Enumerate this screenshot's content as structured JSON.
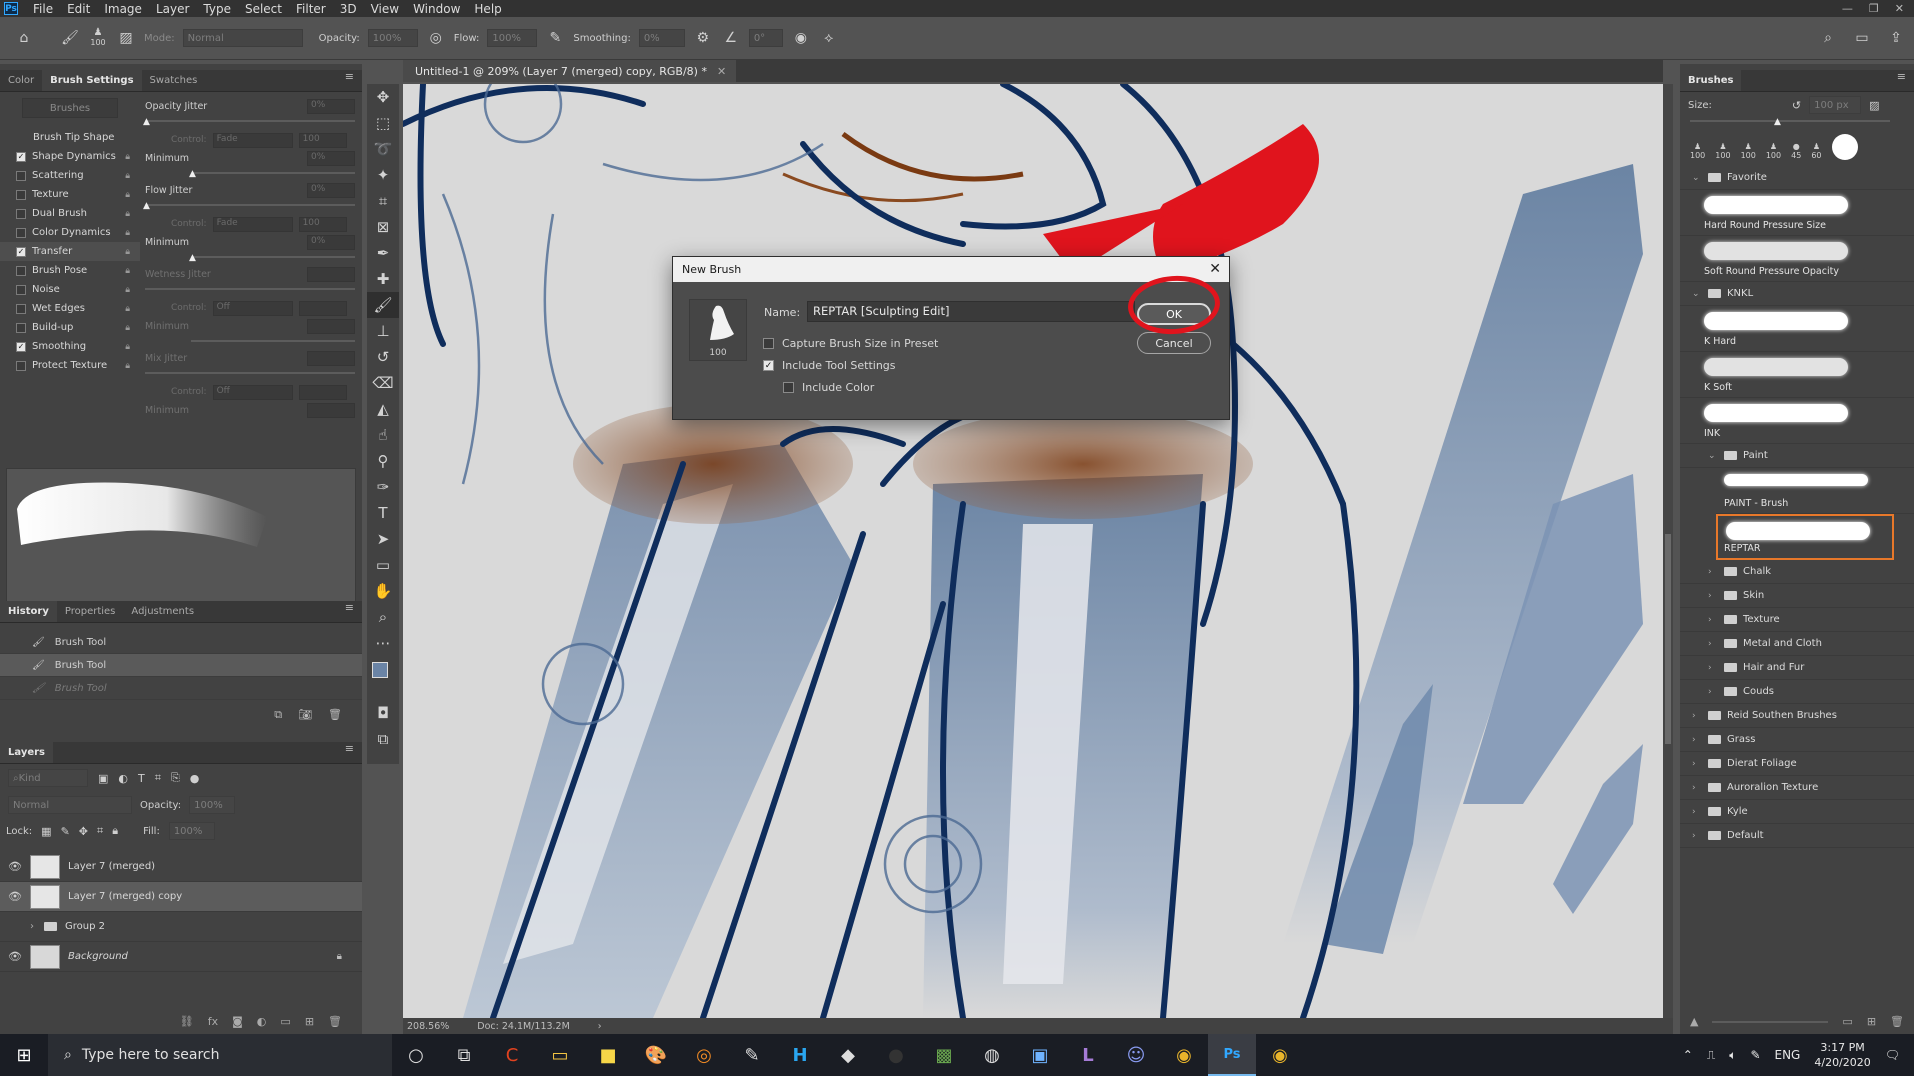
{
  "menubar": {
    "logo": "Ps",
    "items": [
      "File",
      "Edit",
      "Image",
      "Layer",
      "Type",
      "Select",
      "Filter",
      "3D",
      "View",
      "Window",
      "Help"
    ]
  },
  "options_bar": {
    "brush_size": "100",
    "mode_label": "Mode:",
    "mode_value": "Normal",
    "opacity_label": "Opacity:",
    "opacity_value": "100%",
    "flow_label": "Flow:",
    "flow_value": "100%",
    "smoothing_label": "Smoothing:",
    "smoothing_value": "0%",
    "angle_value": "0°"
  },
  "brush_settings_panel": {
    "tabs": [
      "Color",
      "Brush Settings",
      "Swatches"
    ],
    "brushes_button": "Brushes",
    "brush_tip_shape": "Brush Tip Shape",
    "options": [
      {
        "label": "Shape Dynamics",
        "checked": true
      },
      {
        "label": "Scattering",
        "checked": false
      },
      {
        "label": "Texture",
        "checked": false
      },
      {
        "label": "Dual Brush",
        "checked": false
      },
      {
        "label": "Color Dynamics",
        "checked": false
      },
      {
        "label": "Transfer",
        "checked": true
      },
      {
        "label": "Brush Pose",
        "checked": false
      },
      {
        "label": "Noise",
        "checked": false
      },
      {
        "label": "Wet Edges",
        "checked": false
      },
      {
        "label": "Build-up",
        "checked": false
      },
      {
        "label": "Smoothing",
        "checked": true
      },
      {
        "label": "Protect Texture",
        "checked": false
      }
    ],
    "opacity_jitter_label": "Opacity Jitter",
    "opacity_jitter_value": "0%",
    "control_label": "Control:",
    "control_fade": "Fade",
    "control_fade_value": "100",
    "minimum_label": "Minimum",
    "minimum_value": "0%",
    "flow_jitter_label": "Flow Jitter",
    "flow_jitter_value": "0%",
    "wetness_jitter_label": "Wetness Jitter",
    "control_off": "Off",
    "mix_jitter_label": "Mix Jitter"
  },
  "history_panel": {
    "tabs": [
      "History",
      "Properties",
      "Adjustments"
    ],
    "items": [
      {
        "label": "Brush Tool",
        "state": "normal"
      },
      {
        "label": "Brush Tool",
        "state": "selected"
      },
      {
        "label": "Brush Tool",
        "state": "dim"
      }
    ]
  },
  "layers_panel": {
    "tab": "Layers",
    "kind_placeholder": "Kind",
    "blend_mode": "Normal",
    "opacity_label": "Opacity:",
    "opacity_value": "100%",
    "lock_label": "Lock:",
    "fill_label": "Fill:",
    "fill_value": "100%",
    "layers": [
      {
        "name": "Layer 7 (merged)",
        "visible": true,
        "selected": false
      },
      {
        "name": "Layer 7 (merged) copy",
        "visible": true,
        "selected": true
      },
      {
        "name": "Group 2",
        "visible": false,
        "selected": false,
        "type": "group"
      },
      {
        "name": "Background",
        "visible": true,
        "selected": false,
        "locked": true
      }
    ]
  },
  "document": {
    "tab_title": "Untitled-1 @ 209% (Layer 7 (merged) copy, RGB/8) *",
    "zoom": "208.56%",
    "doc_size": "Doc: 24.1M/113.2M"
  },
  "dialog": {
    "title": "New Brush",
    "preview_size": "100",
    "name_label": "Name:",
    "name_value": "REPTAR [Sculpting Edit]",
    "capture_size_label": "Capture Brush Size in Preset",
    "capture_size_checked": false,
    "include_tool_label": "Include Tool Settings",
    "include_tool_checked": true,
    "include_color_label": "Include Color",
    "include_color_checked": false,
    "ok_label": "OK",
    "cancel_label": "Cancel"
  },
  "brushes_panel": {
    "tab": "Brushes",
    "size_label": "Size:",
    "size_value": "100 px",
    "recent_sizes": [
      "100",
      "100",
      "100",
      "100",
      "45",
      "60"
    ],
    "folders": [
      {
        "name": "Favorite",
        "expanded": true,
        "items": [
          "Hard Round Pressure Size",
          "Soft Round Pressure Opacity"
        ]
      },
      {
        "name": "KNKL",
        "expanded": true,
        "items": [
          "K Hard",
          "K Soft",
          "INK"
        ]
      }
    ],
    "paint_folder": "Paint",
    "paint_items": [
      "PAINT - Brush",
      "REPTAR"
    ],
    "selected_brush": "REPTAR",
    "subfolders": [
      "Chalk",
      "Skin",
      "Texture",
      "Metal and Cloth",
      "Hair and Fur",
      "Couds"
    ],
    "top_folders": [
      "Reid Southen Brushes",
      "Grass",
      "Dierat Foliage",
      "Auroralion Texture",
      "Kyle",
      "Default"
    ]
  },
  "taskbar": {
    "search_placeholder": "Type here to search",
    "language": "ENG",
    "time": "3:17 PM",
    "date": "4/20/2020"
  },
  "colors": {
    "annotation_red": "#e0141d",
    "selection_orange": "#e8782a",
    "ink_blue": "#0f2d5c",
    "paint_blue": "#6a84a6",
    "paint_brown": "#7a3a12"
  }
}
